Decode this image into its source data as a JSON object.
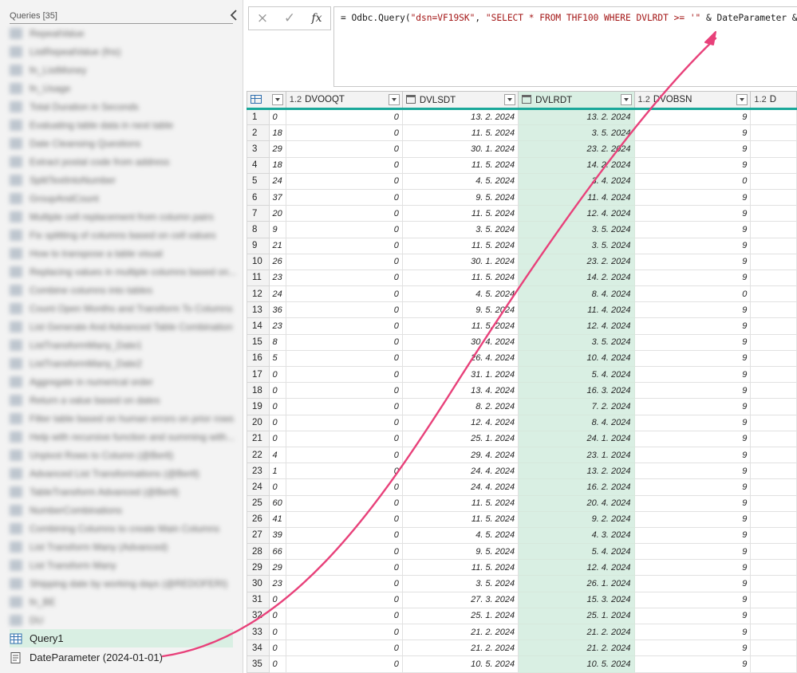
{
  "queries_pane": {
    "title": "Queries [35]",
    "blurred_items": [
      "RepeatValue",
      "ListRepeatValue (fns)",
      "fn_ListMoney",
      "fn_Usage",
      "Total Duration in Seconds",
      "Evaluating table data in next table",
      "Date Cleansing Questions",
      "Extract postal code from address",
      "SplitTextIntoNumber",
      "GroupAndCount",
      "Multiple cell replacement from column pairs",
      "Fix splitting of columns based on cell values",
      "How to transpose a table visual",
      "Replacing values in multiple columns based on...",
      "Combine columns into tables",
      "Count Open Months and Transform To Columns",
      "List Generate And Advanced Table Combination",
      "ListTransformMany_Date1",
      "ListTransformMany_Date2",
      "Aggregate in numerical order",
      "Return a value based on dates",
      "Filter table based on human errors on prior rows",
      "Help with recursive function and summing with...",
      "Unpivot Rows to Column (@Bertl)",
      "Advanced List Transformations (@Bertl)",
      "TableTransform Advanced (@Bertl)",
      "NumberCombinations",
      "Combining Columns to create Main Columns",
      "List Transform Many (Advanced)",
      "List Transform Many",
      "Shipping date by working days (@REDOFERI)",
      "fn_BE",
      "DU"
    ],
    "items": [
      {
        "label": "Query1",
        "icon": "table-icon",
        "selected": true
      },
      {
        "label": "DateParameter (2024-01-01)",
        "icon": "parameter-icon",
        "selected": false
      }
    ]
  },
  "formula_bar": {
    "cancel_icon": "×",
    "commit_icon": "✓",
    "fx_label": "fx",
    "prefix": "= Odbc.Query(",
    "arg1": "\"dsn=VF19SK\"",
    "sep": ", ",
    "arg2": "\"SELECT * FROM THF100 WHERE DVLRDT >= '\"",
    "concat1": " & DateParameter & ",
    "arg3": "\"'\"",
    "suffix": ")"
  },
  "grid": {
    "columns": [
      {
        "type": "1.2",
        "name": "DVOOQT",
        "type_icon": "decimal"
      },
      {
        "type": "",
        "name": "DVLSDT",
        "type_icon": "calendar-icon"
      },
      {
        "type": "",
        "name": "DVLRDT",
        "type_icon": "calendar-icon",
        "selected": true
      },
      {
        "type": "1.2",
        "name": "DVOBSN",
        "type_icon": "decimal"
      },
      {
        "type": "1.2",
        "name": "D",
        "type_icon": "decimal"
      }
    ],
    "rows": [
      [
        "1",
        "0",
        "0",
        "13. 2. 2024",
        "13. 2. 2024",
        "9"
      ],
      [
        "2",
        "18",
        "0",
        "11. 5. 2024",
        "3. 5. 2024",
        "9"
      ],
      [
        "3",
        "29",
        "0",
        "30. 1. 2024",
        "23. 2. 2024",
        "9"
      ],
      [
        "4",
        "18",
        "0",
        "11. 5. 2024",
        "14. 2. 2024",
        "9"
      ],
      [
        "5",
        "24",
        "0",
        "4. 5. 2024",
        "3. 4. 2024",
        "0"
      ],
      [
        "6",
        "37",
        "0",
        "9. 5. 2024",
        "11. 4. 2024",
        "9"
      ],
      [
        "7",
        "20",
        "0",
        "11. 5. 2024",
        "12. 4. 2024",
        "9"
      ],
      [
        "8",
        "9",
        "0",
        "3. 5. 2024",
        "3. 5. 2024",
        "9"
      ],
      [
        "9",
        "21",
        "0",
        "11. 5. 2024",
        "3. 5. 2024",
        "9"
      ],
      [
        "10",
        "26",
        "0",
        "30. 1. 2024",
        "23. 2. 2024",
        "9"
      ],
      [
        "11",
        "23",
        "0",
        "11. 5. 2024",
        "14. 2. 2024",
        "9"
      ],
      [
        "12",
        "24",
        "0",
        "4. 5. 2024",
        "8. 4. 2024",
        "0"
      ],
      [
        "13",
        "36",
        "0",
        "9. 5. 2024",
        "11. 4. 2024",
        "9"
      ],
      [
        "14",
        "23",
        "0",
        "11. 5. 2024",
        "12. 4. 2024",
        "9"
      ],
      [
        "15",
        "8",
        "0",
        "30. 4. 2024",
        "3. 5. 2024",
        "9"
      ],
      [
        "16",
        "5",
        "0",
        "26. 4. 2024",
        "10. 4. 2024",
        "9"
      ],
      [
        "17",
        "0",
        "0",
        "31. 1. 2024",
        "5. 4. 2024",
        "9"
      ],
      [
        "18",
        "0",
        "0",
        "13. 4. 2024",
        "16. 3. 2024",
        "9"
      ],
      [
        "19",
        "0",
        "0",
        "8. 2. 2024",
        "7. 2. 2024",
        "9"
      ],
      [
        "20",
        "0",
        "0",
        "12. 4. 2024",
        "8. 4. 2024",
        "9"
      ],
      [
        "21",
        "0",
        "0",
        "25. 1. 2024",
        "24. 1. 2024",
        "9"
      ],
      [
        "22",
        "4",
        "0",
        "29. 4. 2024",
        "23. 1. 2024",
        "9"
      ],
      [
        "23",
        "1",
        "0",
        "24. 4. 2024",
        "13. 2. 2024",
        "9"
      ],
      [
        "24",
        "0",
        "0",
        "24. 4. 2024",
        "16. 2. 2024",
        "9"
      ],
      [
        "25",
        "60",
        "0",
        "11. 5. 2024",
        "20. 4. 2024",
        "9"
      ],
      [
        "26",
        "41",
        "0",
        "11. 5. 2024",
        "9. 2. 2024",
        "9"
      ],
      [
        "27",
        "39",
        "0",
        "4. 5. 2024",
        "4. 3. 2024",
        "9"
      ],
      [
        "28",
        "66",
        "0",
        "9. 5. 2024",
        "5. 4. 2024",
        "9"
      ],
      [
        "29",
        "29",
        "0",
        "11. 5. 2024",
        "12. 4. 2024",
        "9"
      ],
      [
        "30",
        "23",
        "0",
        "3. 5. 2024",
        "26. 1. 2024",
        "9"
      ],
      [
        "31",
        "0",
        "0",
        "27. 3. 2024",
        "15. 3. 2024",
        "9"
      ],
      [
        "32",
        "0",
        "0",
        "25. 1. 2024",
        "25. 1. 2024",
        "9"
      ],
      [
        "33",
        "0",
        "0",
        "21. 2. 2024",
        "21. 2. 2024",
        "9"
      ],
      [
        "34",
        "0",
        "0",
        "21. 2. 2024",
        "21. 2. 2024",
        "9"
      ],
      [
        "35",
        "0",
        "0",
        "10. 5. 2024",
        "10. 5. 2024",
        "9"
      ]
    ]
  },
  "colors": {
    "accent_teal": "#1aa89a",
    "selected_bg": "#d9efe3",
    "arrow": "#e8417a",
    "string_red": "#a31515"
  }
}
